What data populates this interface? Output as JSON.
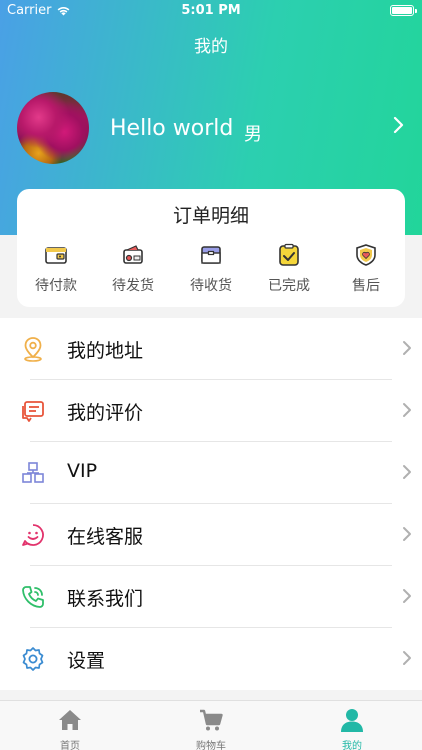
{
  "status_bar": {
    "carrier": "Carrier",
    "time": "5:01 PM"
  },
  "nav": {
    "title": "我的"
  },
  "profile": {
    "username": "Hello world",
    "gender": "男"
  },
  "orders": {
    "title": "订单明细",
    "items": [
      {
        "label": "待付款",
        "icon": "wallet-icon"
      },
      {
        "label": "待发货",
        "icon": "package-ship-icon"
      },
      {
        "label": "待收货",
        "icon": "box-receive-icon"
      },
      {
        "label": "已完成",
        "icon": "clipboard-check-icon"
      },
      {
        "label": "售后",
        "icon": "shield-heart-icon"
      }
    ]
  },
  "menu": {
    "items": [
      {
        "label": "我的地址",
        "icon": "location-pin-icon",
        "color": "#f0b04a"
      },
      {
        "label": "我的评价",
        "icon": "comment-icon",
        "color": "#e8553b"
      },
      {
        "label": "VIP",
        "icon": "vip-grid-icon",
        "color": "#7d86d8"
      },
      {
        "label": "在线客服",
        "icon": "smile-chat-icon",
        "color": "#e2336c"
      },
      {
        "label": "联系我们",
        "icon": "phone-icon",
        "color": "#2fbf6a"
      },
      {
        "label": "设置",
        "icon": "gear-icon",
        "color": "#3a8bd1"
      }
    ]
  },
  "tabs": {
    "items": [
      {
        "label": "首页",
        "icon": "home-icon"
      },
      {
        "label": "购物车",
        "icon": "cart-icon"
      },
      {
        "label": "我的",
        "icon": "user-icon",
        "active": true
      }
    ]
  },
  "colors": {
    "accent": "#22b8a6",
    "header_start": "#4aa0e6",
    "header_end": "#22d59a"
  }
}
